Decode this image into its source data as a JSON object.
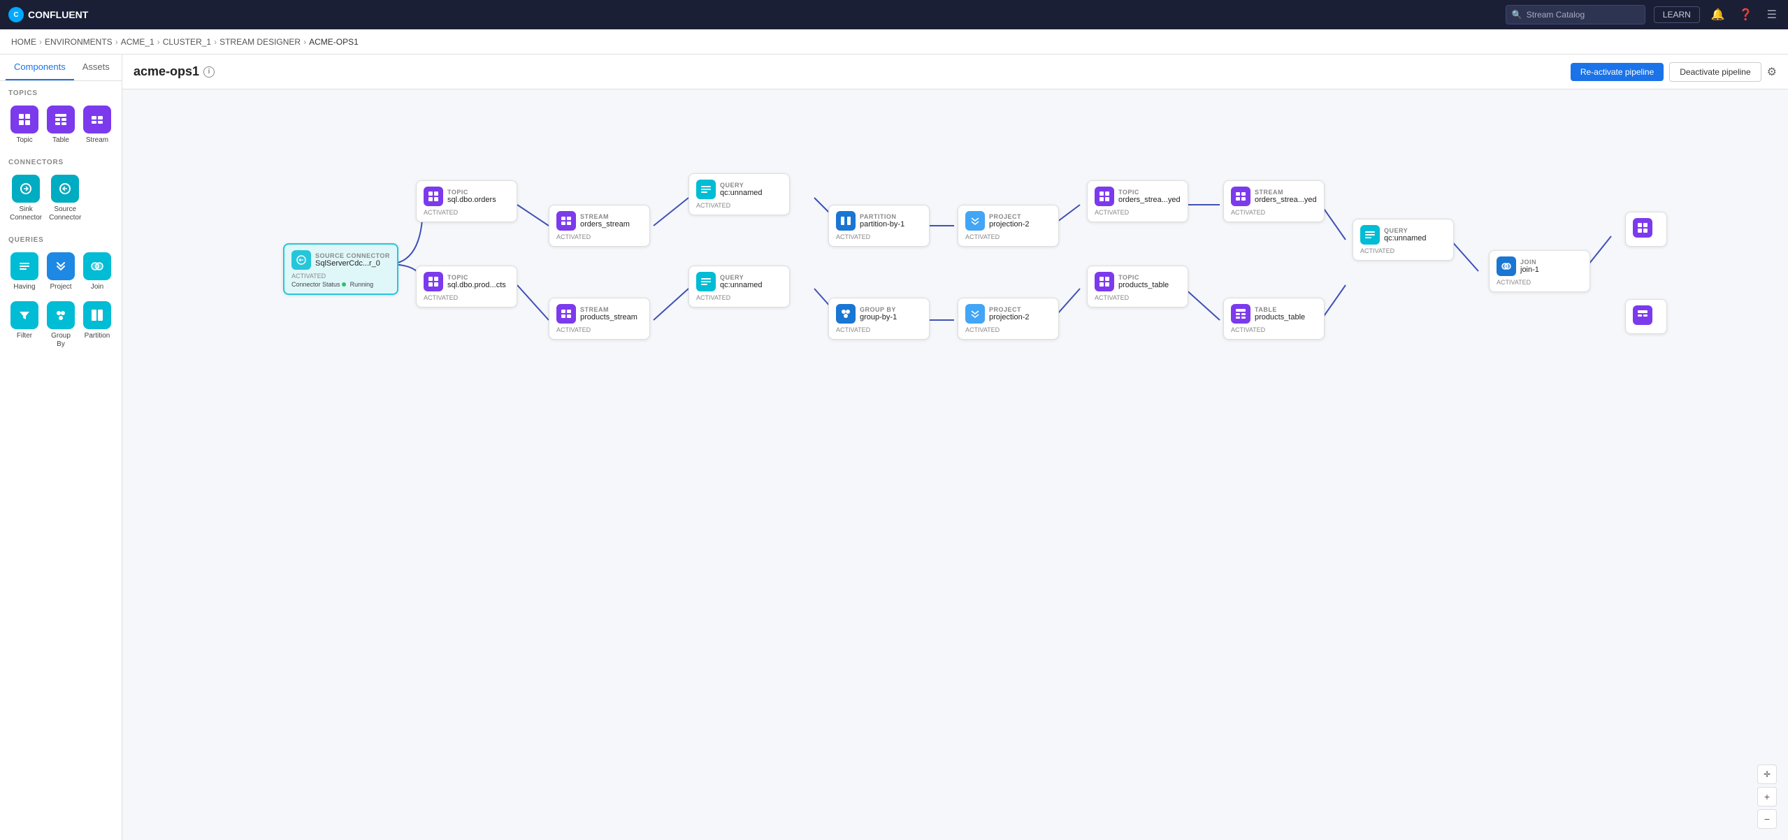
{
  "app": {
    "name": "CONFLUENT"
  },
  "nav": {
    "search_placeholder": "Stream Catalog",
    "learn_btn": "LEARN",
    "breadcrumbs": [
      "HOME",
      "ENVIRONMENTS",
      "ACME_1",
      "CLUSTER_1",
      "STREAM DESIGNER",
      "ACME-OPS1"
    ]
  },
  "tabs": {
    "components": "Components",
    "assets": "Assets"
  },
  "sidebar": {
    "topics_title": "TOPICS",
    "connectors_title": "CONNECTORS",
    "queries_title": "QUERIES",
    "topic_label": "Topic",
    "table_label": "Table",
    "stream_label": "Stream",
    "sink_connector_label": "Sink Connector",
    "source_connector_label": "Source Connector",
    "having_label": "Having",
    "project_label": "Project",
    "join_label": "Join",
    "filter_label": "Filter",
    "group_by_label": "Group By",
    "partition_label": "Partition"
  },
  "pipeline": {
    "title": "acme-ops1",
    "reactivate_btn": "Re-activate pipeline",
    "deactivate_btn": "Deactivate pipeline"
  },
  "nodes": {
    "source_connector": {
      "type": "SOURCE CONNECTOR",
      "name": "SqlServerCdc...r_0",
      "status": "ACTIVATED",
      "connector_status_label": "Connector Status",
      "connector_status": "Running"
    },
    "topic1": {
      "type": "TOPIC",
      "name": "sql.dbo.orders",
      "status": "ACTIVATED"
    },
    "stream1": {
      "type": "STREAM",
      "name": "orders_stream",
      "status": "ACTIVATED"
    },
    "query1": {
      "type": "QUERY",
      "name": "qc:unnamed",
      "status": "ACTIVATED"
    },
    "partition1": {
      "type": "PARTITION",
      "name": "partition-by-1",
      "status": "ACTIVATED"
    },
    "project1": {
      "type": "PROJECT",
      "name": "projection-2",
      "status": "ACTIVATED"
    },
    "topic2": {
      "type": "TOPIC",
      "name": "orders_strea...yed",
      "status": "ACTIVATED"
    },
    "stream2": {
      "type": "STREAM",
      "name": "orders_strea...yed",
      "status": "ACTIVATED"
    },
    "query_right": {
      "type": "QUERY",
      "name": "qc:unnamed",
      "status": "ACTIVATED"
    },
    "join1": {
      "type": "JOIN",
      "name": "join-1",
      "status": "ACTIVATED"
    },
    "topic3": {
      "type": "TOPIC",
      "name": "sql.dbo.prod...cts",
      "status": "ACTIVATED"
    },
    "stream3": {
      "type": "STREAM",
      "name": "products_stream",
      "status": "ACTIVATED"
    },
    "query2": {
      "type": "QUERY",
      "name": "qc:unnamed",
      "status": "ACTIVATED"
    },
    "group_by1": {
      "type": "GROUP BY",
      "name": "group-by-1",
      "status": "ACTIVATED"
    },
    "project2": {
      "type": "PROJECT",
      "name": "projection-2",
      "status": "ACTIVATED"
    },
    "topic4": {
      "type": "TOPIC",
      "name": "products_table",
      "status": "ACTIVATED"
    },
    "table1": {
      "type": "TABLE",
      "name": "products_table",
      "status": "ACTIVATED"
    }
  },
  "zoom_controls": {
    "crosshair": "⊕",
    "plus": "+",
    "minus": "−"
  }
}
